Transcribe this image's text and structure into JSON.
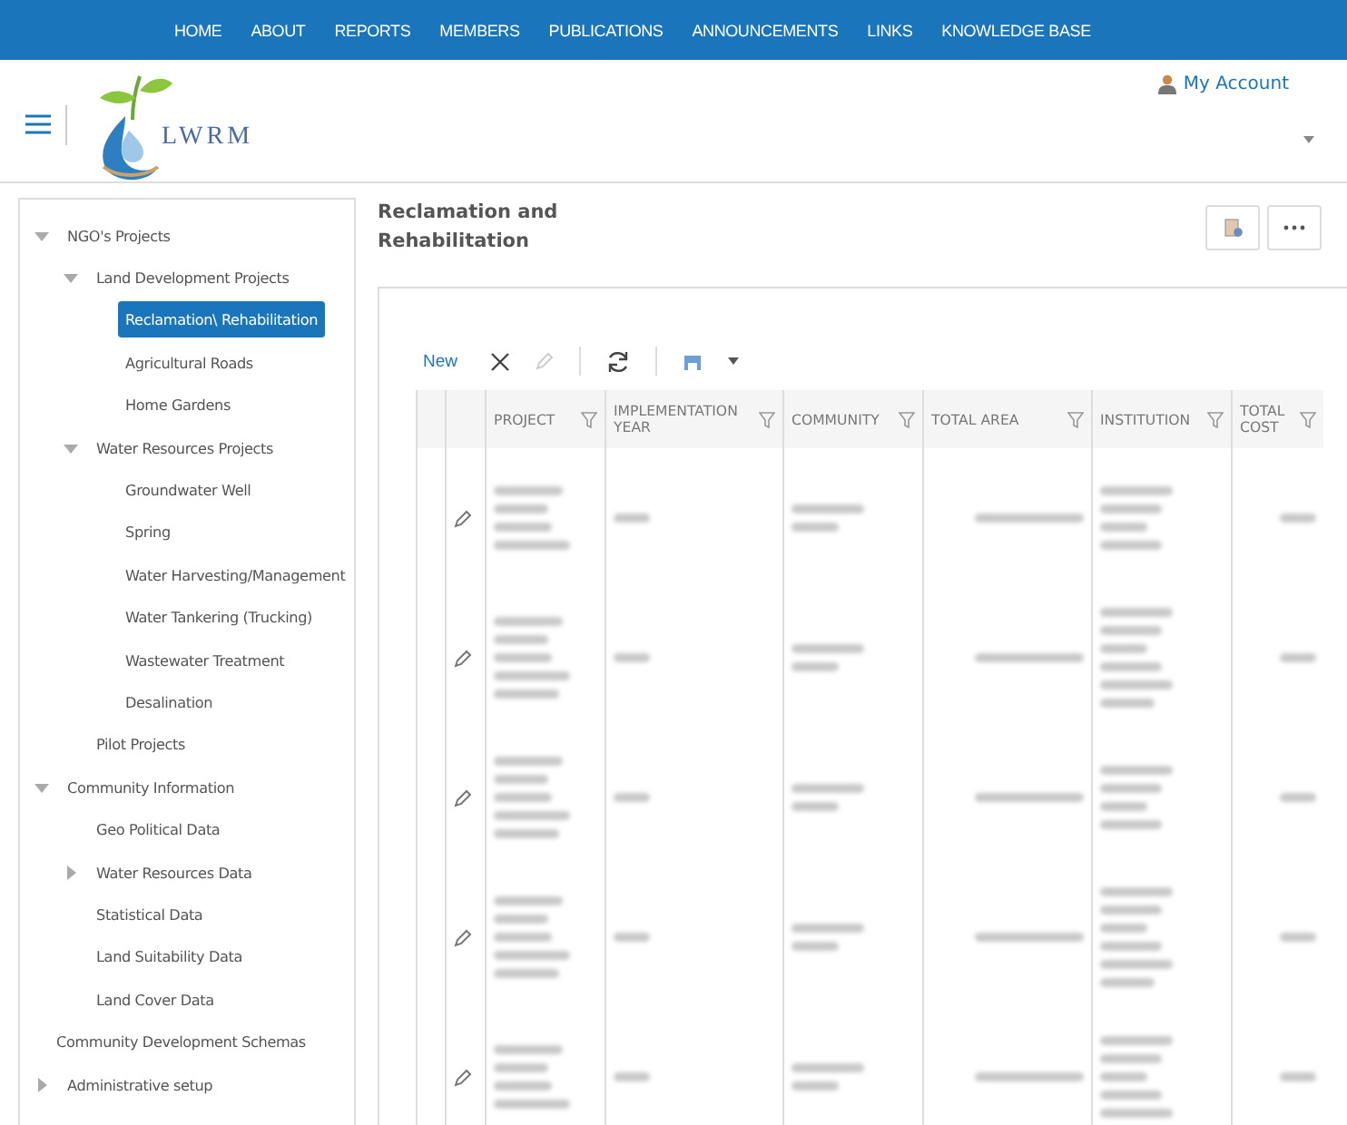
{
  "nav": [
    "HOME",
    "ABOUT",
    "REPORTS",
    "MEMBERS",
    "PUBLICATIONS",
    "ANNOUNCEMENTS",
    "LINKS",
    "KNOWLEDGE BASE"
  ],
  "logo": {
    "text": "LWRM"
  },
  "account": {
    "label": "My Account"
  },
  "sidebar": {
    "items": [
      {
        "label": "NGO's Projects",
        "expanded": true,
        "selected": false,
        "children": [
          {
            "label": "Land Development Projects",
            "expanded": true,
            "selected": false,
            "children": [
              {
                "label": "Reclamation\\ Rehabilitation",
                "selected": true
              },
              {
                "label": "Agricultural Roads",
                "selected": false
              },
              {
                "label": "Home Gardens",
                "selected": false
              }
            ]
          },
          {
            "label": "Water Resources Projects",
            "expanded": true,
            "selected": false,
            "children": [
              {
                "label": "Groundwater Well",
                "selected": false
              },
              {
                "label": "Spring",
                "selected": false
              },
              {
                "label": "Water Harvesting/Management",
                "selected": false
              },
              {
                "label": "Water Tankering (Trucking)",
                "selected": false
              },
              {
                "label": "Wastewater Treatment",
                "selected": false
              },
              {
                "label": "Desalination",
                "selected": false
              }
            ]
          },
          {
            "label": "Pilot Projects",
            "selected": false
          }
        ]
      },
      {
        "label": "Community Information",
        "expanded": true,
        "selected": false,
        "children": [
          {
            "label": "Geo Political Data",
            "selected": false
          },
          {
            "label": "Water Resources Data",
            "expanded": false,
            "selected": false
          },
          {
            "label": "Statistical Data",
            "selected": false
          },
          {
            "label": "Land Suitability Data",
            "selected": false
          },
          {
            "label": "Land Cover Data",
            "selected": false
          }
        ]
      },
      {
        "label": "Community Development Schemas",
        "selected": false
      },
      {
        "label": "Administrative setup",
        "expanded": false,
        "selected": false
      }
    ]
  },
  "page": {
    "title": "Reclamation and Rehabilitation"
  },
  "toolbar": {
    "new_label": "New"
  },
  "table": {
    "columns": [
      {
        "label": "PROJECT",
        "kind": "text"
      },
      {
        "label": "IMPLEMENTATION YEAR",
        "kind": "text"
      },
      {
        "label": "COMMUNITY",
        "kind": "text"
      },
      {
        "label": "TOTAL AREA",
        "kind": "number"
      },
      {
        "label": "INSTITUTION",
        "kind": "text"
      },
      {
        "label": "TOTAL COST",
        "kind": "number"
      }
    ],
    "rows": [
      {
        "editable": true
      },
      {
        "editable": true
      },
      {
        "editable": true
      },
      {
        "editable": true
      },
      {
        "editable": true
      }
    ]
  }
}
